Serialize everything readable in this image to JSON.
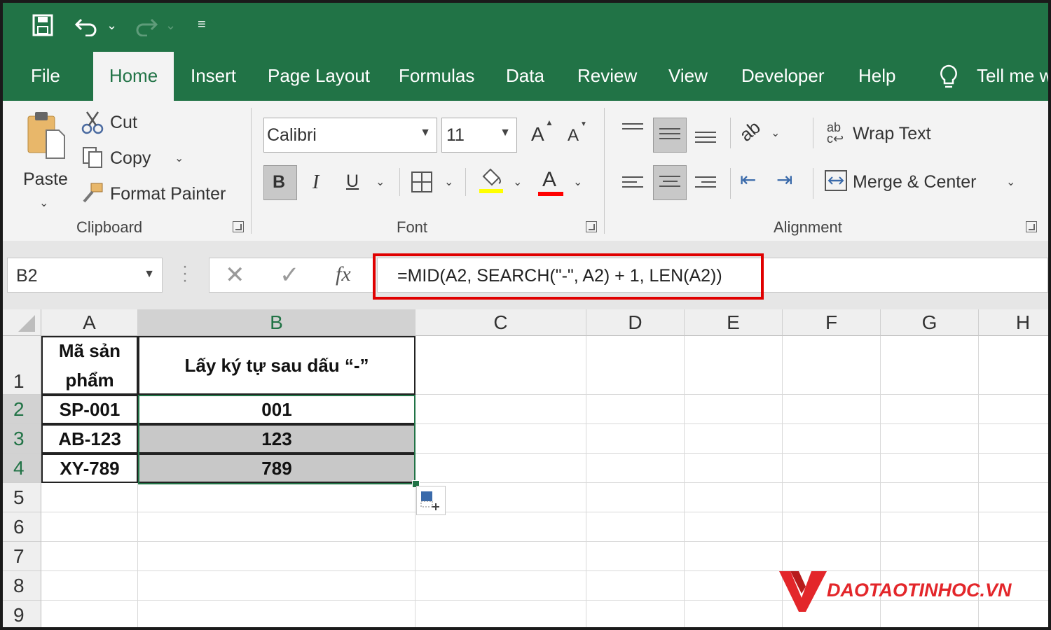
{
  "tabs": [
    "File",
    "Home",
    "Insert",
    "Page Layout",
    "Formulas",
    "Data",
    "Review",
    "View",
    "Developer",
    "Help"
  ],
  "tell_me": "Tell me w",
  "clipboard": {
    "paste": "Paste",
    "cut": "Cut",
    "copy": "Copy",
    "format_painter": "Format Painter",
    "group": "Clipboard"
  },
  "font": {
    "name": "Calibri",
    "size": "11",
    "bold": "B",
    "italic": "I",
    "underline": "U",
    "color_letter": "A",
    "grow": "A",
    "shrink": "A",
    "group": "Font",
    "highlight_color": "#ffff00",
    "font_color": "#ff0000"
  },
  "alignment": {
    "wrap_text": "Wrap Text",
    "merge_center": "Merge & Center",
    "group": "Alignment"
  },
  "namebox": "B2",
  "formula": "=MID(A2, SEARCH(\"-\", A2) + 1, LEN(A2))",
  "columns": [
    "A",
    "B",
    "C",
    "D",
    "E",
    "F",
    "G",
    "H"
  ],
  "rows": [
    "1",
    "2",
    "3",
    "4",
    "5",
    "6",
    "7",
    "8",
    "9"
  ],
  "cells": {
    "A1": "Mã sản phẩm",
    "B1": "Lấy ký tự sau dấu “-”",
    "A2": "SP-001",
    "B2": "001",
    "A3": "AB-123",
    "B3": "123",
    "A4": "XY-789",
    "B4": "789"
  },
  "watermark": "DAOTAOTINHOC.VN",
  "colors": {
    "accent": "#217346",
    "highlight_box": "#e00000",
    "brand": "#e3262a"
  }
}
